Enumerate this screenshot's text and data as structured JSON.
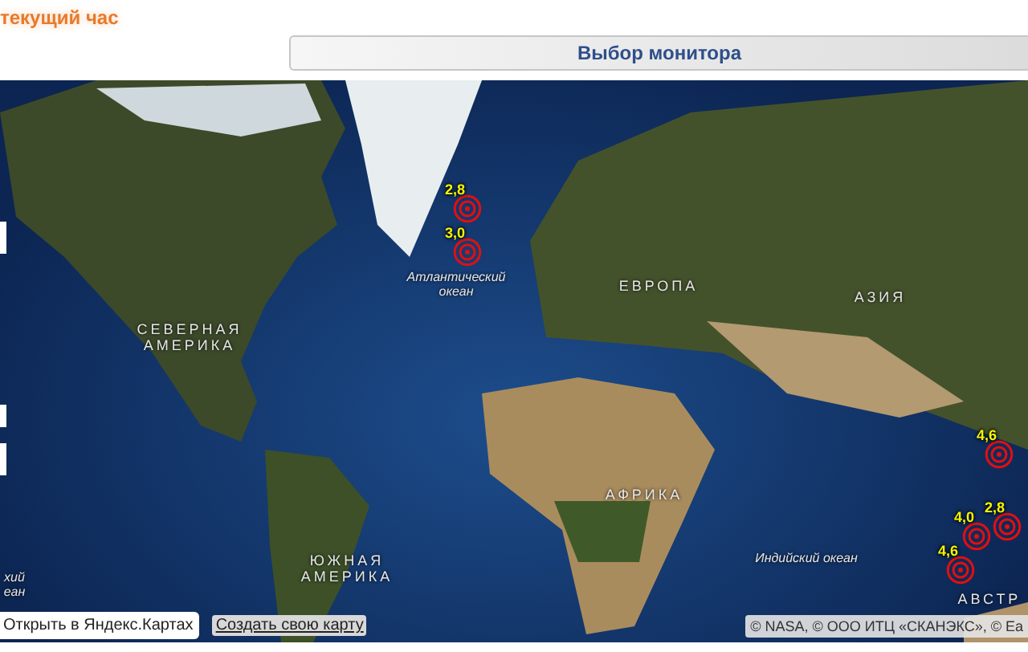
{
  "header": {
    "title": "текущий час"
  },
  "monitor_button": {
    "label": "Выбор монитора"
  },
  "map": {
    "labels": [
      {
        "kind": "continent",
        "text": "СЕВЕРНАЯ АМЕРИКА"
      },
      {
        "kind": "ocean",
        "text": "Атлантический океан"
      },
      {
        "kind": "continent",
        "text": "ЕВРОПА"
      },
      {
        "kind": "continent",
        "text": "АЗИЯ"
      },
      {
        "kind": "continent",
        "text": "АФРИКА"
      },
      {
        "kind": "continent",
        "text": "ЮЖНАЯ АМЕРИКА"
      },
      {
        "kind": "ocean",
        "text": "Индийский океан"
      },
      {
        "kind": "ocean",
        "text": "хий еан"
      },
      {
        "kind": "continent",
        "text": "АВСТР"
      }
    ],
    "markers": [
      {
        "magnitude": "2,8"
      },
      {
        "magnitude": "3,0"
      },
      {
        "magnitude": "4,6"
      },
      {
        "magnitude": "4,0"
      },
      {
        "magnitude": "2,8"
      },
      {
        "magnitude": "4,6"
      }
    ],
    "open_button": {
      "label": "Открыть в Яндекс.Картах"
    },
    "create_link": {
      "label": "Создать свою карту"
    },
    "copyright": "© NASA, © ООО ИТЦ «СКАНЭКС», © Ea"
  }
}
